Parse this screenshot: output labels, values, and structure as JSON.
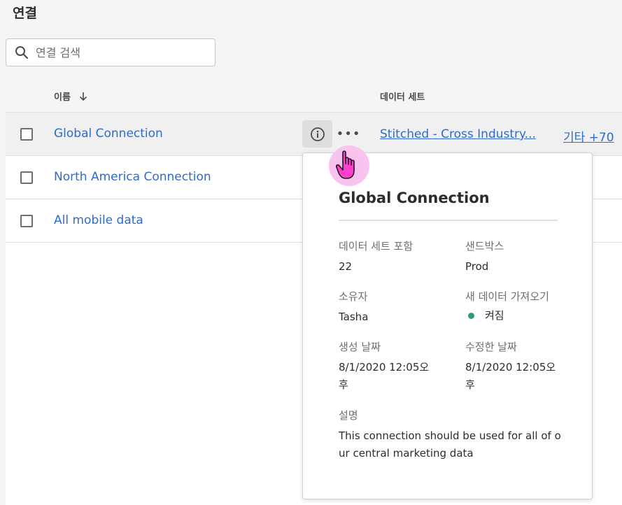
{
  "page_title": "연결",
  "search": {
    "placeholder": "연결 검색",
    "value": ""
  },
  "columns": {
    "name": "이름",
    "dataset": "데이터 세트"
  },
  "rows": [
    {
      "name": "Global Connection",
      "dataset": "Stitched - Cross Industry...",
      "more": "기타 +70"
    },
    {
      "name": "North America Connection"
    },
    {
      "name": "All mobile data"
    }
  ],
  "more_actions_label": "•••",
  "popover": {
    "title": "Global Connection",
    "datasets_label": "데이터 세트 포함",
    "datasets_value": "22",
    "sandbox_label": "샌드박스",
    "sandbox_value": "Prod",
    "owner_label": "소유자",
    "owner_value": "Tasha",
    "import_label": "새 데이터 가져오기",
    "import_value": "켜짐",
    "created_label": "생성 날짜",
    "created_value": "8/1/2020 12:05오후",
    "modified_label": "수정한 날짜",
    "modified_value": "8/1/2020 12:05오후",
    "description_label": "설명",
    "description_value": "This connection should be used for all of our central marketing data"
  },
  "colors": {
    "link": "#2d6bd0",
    "status_on": "#2d9d78",
    "cursor_highlight": "#f9c3f0"
  },
  "icons": [
    "search-icon",
    "sort-down-icon",
    "info-icon",
    "more-icon",
    "hand-cursor-icon"
  ]
}
